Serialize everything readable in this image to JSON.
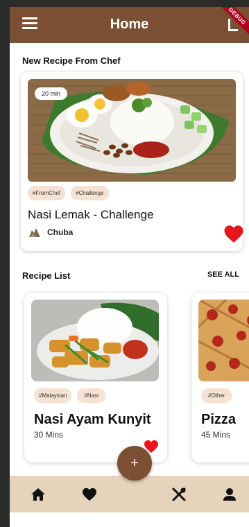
{
  "appbar": {
    "title": "Home",
    "debug_label": "DEBUG"
  },
  "chef_section": {
    "title": "New Recipe From Chef",
    "card": {
      "time": "20 min",
      "tags": [
        "#FromChef",
        "#Challenge"
      ],
      "name": "Nasi Lemak - Challenge",
      "author": "Chuba",
      "favorited": true
    }
  },
  "recipe_section": {
    "title": "Recipe List",
    "see_all": "SEE ALL",
    "recipes": [
      {
        "tags": [
          "#Malaysian",
          "#Nasi"
        ],
        "name": "Nasi Ayam Kunyit",
        "time": "30 Mins",
        "favorited": true
      },
      {
        "tags": [
          "#Other"
        ],
        "name": "Pizza",
        "time": "45 Mins",
        "favorited": false
      }
    ]
  },
  "fab_label": "+",
  "bottom_nav": [
    "home-icon",
    "heart-icon",
    "utensils-icon",
    "person-icon"
  ],
  "colors": {
    "primary": "#7a4f33",
    "bottom_bar": "#e6d3bb",
    "tag_bg": "#f6e2d2",
    "heart": "#e5171c"
  }
}
